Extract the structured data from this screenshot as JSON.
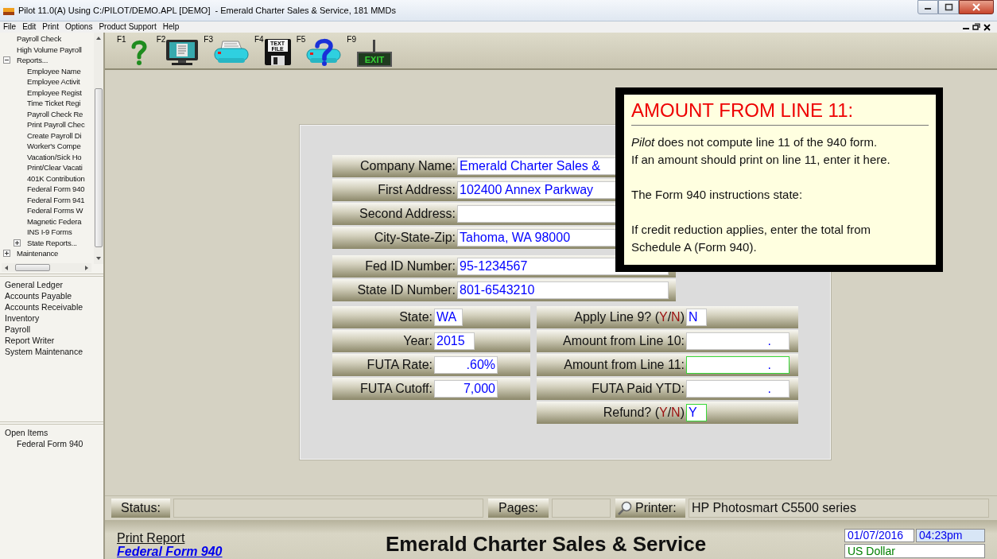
{
  "window": {
    "title": "Pilot 11.0(A) Using C:/PILOT/DEMO.APL [DEMO]  - Emerald Charter Sales & Service, 181 MMDs"
  },
  "menu": [
    "File",
    "Edit",
    "Print",
    "Options",
    "Product Support",
    "Help"
  ],
  "tree": [
    {
      "label": "Payroll Check"
    },
    {
      "label": "High Volume Payroll"
    },
    {
      "label": "Reports...",
      "expanded": true,
      "children": [
        {
          "label": "Employee Name"
        },
        {
          "label": "Employee Activit"
        },
        {
          "label": "Employee Regist"
        },
        {
          "label": "Time Ticket Regi"
        },
        {
          "label": "Payroll Check Re"
        },
        {
          "label": "Print Payroll Chec"
        },
        {
          "label": "Create Payroll Di"
        },
        {
          "label": "Worker's Compe"
        },
        {
          "label": "Vacation/Sick Ho"
        },
        {
          "label": "Print/Clear Vacati"
        },
        {
          "label": "401K Contribution"
        },
        {
          "label": "Federal Form 940"
        },
        {
          "label": "Federal Form 941"
        },
        {
          "label": "Federal Forms W"
        },
        {
          "label": "Magnetic Federa"
        },
        {
          "label": "INS I-9 Forms"
        },
        {
          "label": "State Reports...",
          "expanded": false
        }
      ]
    },
    {
      "label": "Maintenance",
      "expanded": false
    }
  ],
  "modules": [
    "General Ledger",
    "Accounts Payable",
    "Accounts Receivable",
    "Inventory",
    "Payroll",
    "Report Writer",
    "System Maintenance"
  ],
  "open_items": {
    "title": "Open Items",
    "items": [
      "Federal Form 940"
    ]
  },
  "toolbar": [
    {
      "key": "F1",
      "kind": "help"
    },
    {
      "key": "F2",
      "kind": "screen"
    },
    {
      "key": "F3",
      "kind": "printer"
    },
    {
      "key": "F4",
      "kind": "textfile",
      "icon_text": [
        "TEXT",
        "FILE"
      ]
    },
    {
      "key": "F5",
      "kind": "printer_help"
    },
    {
      "key": "F9",
      "kind": "exit",
      "icon_text": [
        "EXIT"
      ]
    }
  ],
  "form": {
    "upper_groups": [
      [
        {
          "label": "Company Name:",
          "value": "Emerald Charter Sales &"
        },
        {
          "label": "First Address:",
          "value": "102400 Annex Parkway"
        },
        {
          "label": "Second Address:"
        },
        {
          "label": "City-State-Zip:",
          "value": "Tahoma, WA  98000"
        }
      ],
      [
        {
          "label": "Fed ID Number:",
          "value": "95-1234567"
        },
        {
          "label": "State ID Number:",
          "value": "801-6543210"
        }
      ]
    ],
    "left_fields": [
      {
        "label": "State:",
        "value": "WA",
        "kind": "code"
      },
      {
        "label": "Year:",
        "value": "2015",
        "kind": "year"
      },
      {
        "label": "FUTA Rate:",
        "value": ".60%",
        "kind": "number"
      },
      {
        "label": "FUTA Cutoff:",
        "value": "7,000",
        "kind": "number"
      }
    ],
    "right_fields": [
      {
        "label": "Apply Line 9?",
        "hint": [
          "(",
          "Y",
          "/",
          "N",
          ")"
        ],
        "value": "N",
        "kind": "yn",
        "focused": false
      },
      {
        "label": "Amount from Line 10:",
        "value": ".",
        "kind": "amount",
        "focused": false
      },
      {
        "label": "Amount from Line 11:",
        "value": ".",
        "kind": "amount",
        "focused": true
      },
      {
        "label": "FUTA Paid YTD:",
        "value": ".",
        "kind": "amount",
        "focused": false
      },
      {
        "label": "Refund?",
        "hint": [
          "(",
          "Y",
          "/",
          "N",
          ")"
        ],
        "value": "Y",
        "kind": "yn",
        "focused": true
      }
    ]
  },
  "help_popup": {
    "title": "AMOUNT FROM LINE 11:",
    "paragraphs": [
      [
        "*Pilot* does not compute line 11 of the 940 form.",
        "If an amount should print on line 11, enter it here."
      ],
      [
        "The Form 940 instructions state:"
      ],
      [
        "If credit reduction applies, enter the total from",
        "Schedule A (Form 940)."
      ]
    ]
  },
  "status_bar": {
    "status_label": "Status:",
    "pages_label": "Pages:",
    "printer_label": "Printer:",
    "printer": "HP Photosmart C5500 series"
  },
  "footer": {
    "action": "Print Report",
    "document": "Federal Form 940",
    "company": "Emerald Charter Sales & Service",
    "date": "01/07/2016",
    "time": "04:23pm",
    "currency": "US Dollar"
  }
}
